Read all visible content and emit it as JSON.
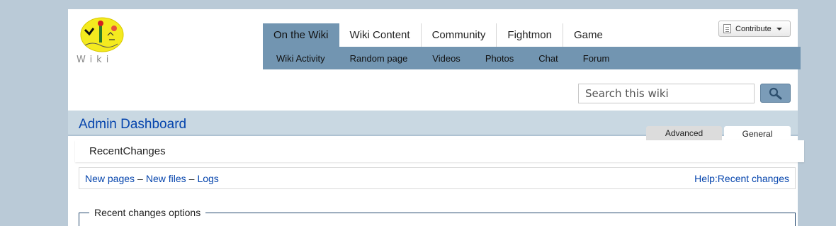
{
  "logo": {
    "name": "wiki-logo",
    "wordmark": "Wiki"
  },
  "nav": {
    "tabs": [
      {
        "label": "On the Wiki",
        "active": true
      },
      {
        "label": "Wiki Content",
        "active": false
      },
      {
        "label": "Community",
        "active": false
      },
      {
        "label": "Fightmon",
        "active": false
      },
      {
        "label": "Game",
        "active": false
      }
    ],
    "sub_items": [
      "Wiki Activity",
      "Random page",
      "Videos",
      "Photos",
      "Chat",
      "Forum"
    ]
  },
  "contribute": {
    "label": "Contribute",
    "icon": "page-icon"
  },
  "search": {
    "placeholder": "Search this wiki",
    "button_icon": "magnifier-icon"
  },
  "admin": {
    "title": "Admin Dashboard",
    "tabs": [
      "Advanced",
      "General"
    ],
    "active_tab": "General"
  },
  "page": {
    "title": "RecentChanges",
    "links": [
      "New pages",
      "New files",
      "Logs"
    ],
    "separator": "–",
    "help_link": "Help:Recent changes",
    "options_legend": "Recent changes options"
  },
  "colors": {
    "accent": "#7295b1",
    "link": "#0645ad",
    "background": "#bacad7"
  }
}
